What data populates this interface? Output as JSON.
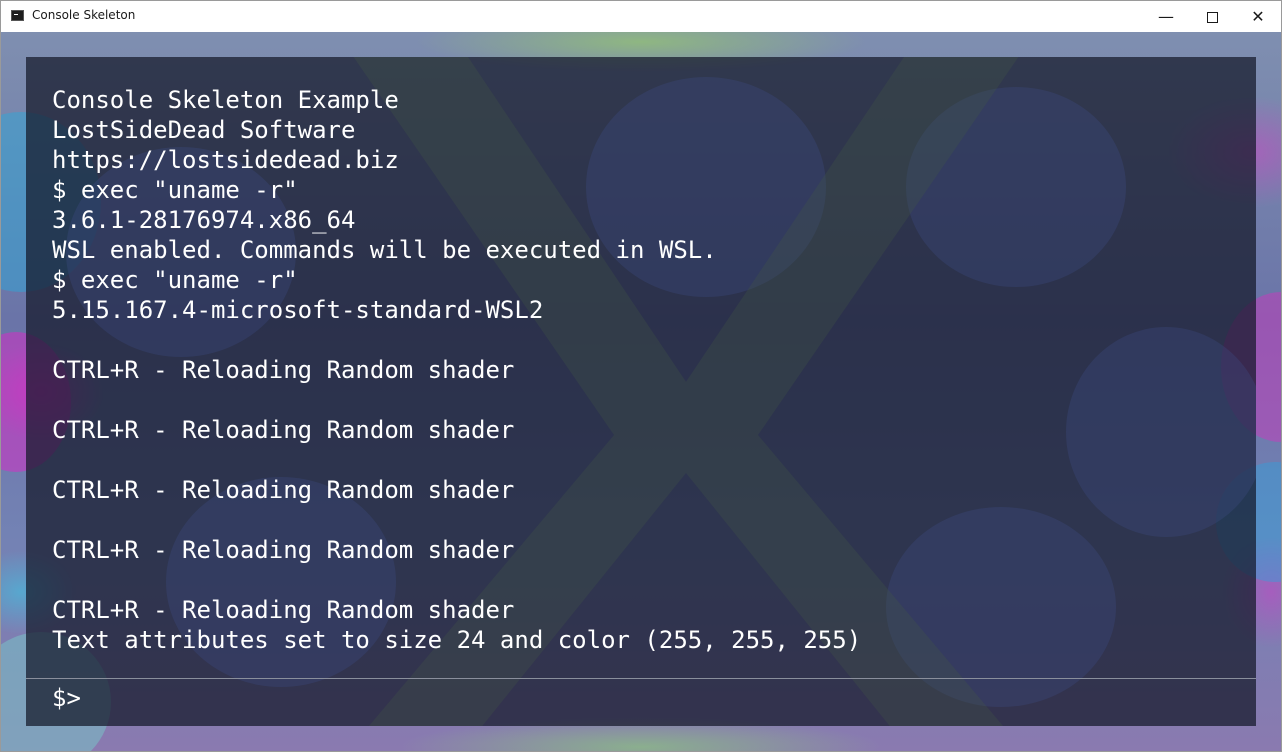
{
  "window": {
    "title": "Console Skeleton",
    "minimize_glyph": "—",
    "close_glyph": "✕"
  },
  "console": {
    "lines": [
      "Console Skeleton Example",
      "LostSideDead Software",
      "https://lostsidedead.biz",
      "$ exec \"uname -r\"",
      "3.6.1-28176974.x86_64",
      "WSL enabled. Commands will be executed in WSL.",
      "$ exec \"uname -r\"",
      "5.15.167.4-microsoft-standard-WSL2",
      "",
      "CTRL+R - Reloading Random shader",
      "",
      "CTRL+R - Reloading Random shader",
      "",
      "CTRL+R - Reloading Random shader",
      "",
      "CTRL+R - Reloading Random shader",
      "",
      "CTRL+R - Reloading Random shader",
      "Text attributes set to size 24 and color (255, 255, 255)"
    ],
    "prompt": "$>",
    "input_value": ""
  },
  "colors": {
    "text": "#ffffff",
    "panel": "#141828"
  }
}
